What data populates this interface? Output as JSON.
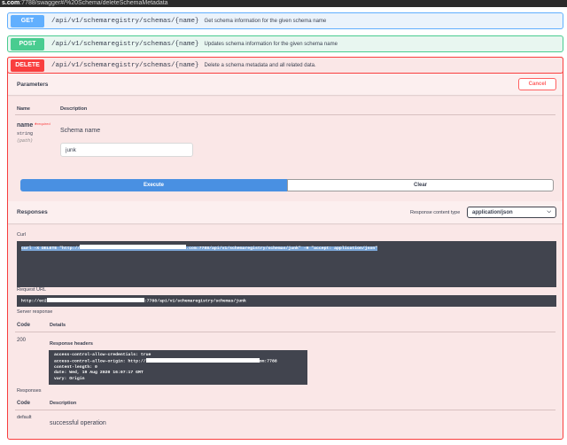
{
  "browser": {
    "url_host": "s.com",
    "url_path": ":7788/swagger#/%20Schema/deleteSchemaMetadata"
  },
  "endpoints": [
    {
      "method": "GET",
      "path": "/api/v1/schemaregistry/schemas/{name}",
      "description": "Get schema information for the given schema name",
      "color": "#61affe"
    },
    {
      "method": "POST",
      "path": "/api/v1/schemaregistry/schemas/{name}",
      "description": "Updates schema information for the given schema name",
      "color": "#49cc90"
    },
    {
      "method": "DELETE",
      "path": "/api/v1/schemaregistry/schemas/{name}",
      "description": "Delete a schema metadata and all related data.",
      "color": "#f93e3e"
    }
  ],
  "parameters": {
    "title": "Parameters",
    "cancel_label": "Cancel",
    "col_name": "Name",
    "col_description": "Description",
    "param": {
      "name": "name",
      "required_mark": "*",
      "required_label": "required",
      "type": "string",
      "location": "(path)",
      "description": "Schema name",
      "value": "junk"
    }
  },
  "actions": {
    "execute_label": "Execute",
    "clear_label": "Clear"
  },
  "responses": {
    "title": "Responses",
    "content_type_label": "Response content type",
    "content_type_value": "application/json",
    "curl_label": "Curl",
    "curl_prefix": "curl -X DELETE \"http://",
    "curl_suffix": ".com:7788/api/v1/schemaregistry/schemas/junk\" -H \"accept: application/json\"",
    "request_url_label": "Request URL",
    "request_url_prefix": "http://ec2",
    "request_url_suffix": ":7788/api/v1/schemaregistry/schemas/junk",
    "server_response_label": "Server response",
    "col_code": "Code",
    "col_details": "Details",
    "code": "200",
    "response_headers_label": "Response headers",
    "headers": {
      "h1": "access-control-allow-credentials: true",
      "h2_prefix": "access-control-allow-origin: http://",
      "h2_suffix": "om:7788",
      "h3": "content-length: 0",
      "h4": "date: Wed, 19 Aug 2020 16:07:17 GMT",
      "h5": "vary: Origin"
    },
    "documented_title": "Responses",
    "col_code2": "Code",
    "col_description2": "Description",
    "default_code": "default",
    "default_description": "successful operation"
  }
}
